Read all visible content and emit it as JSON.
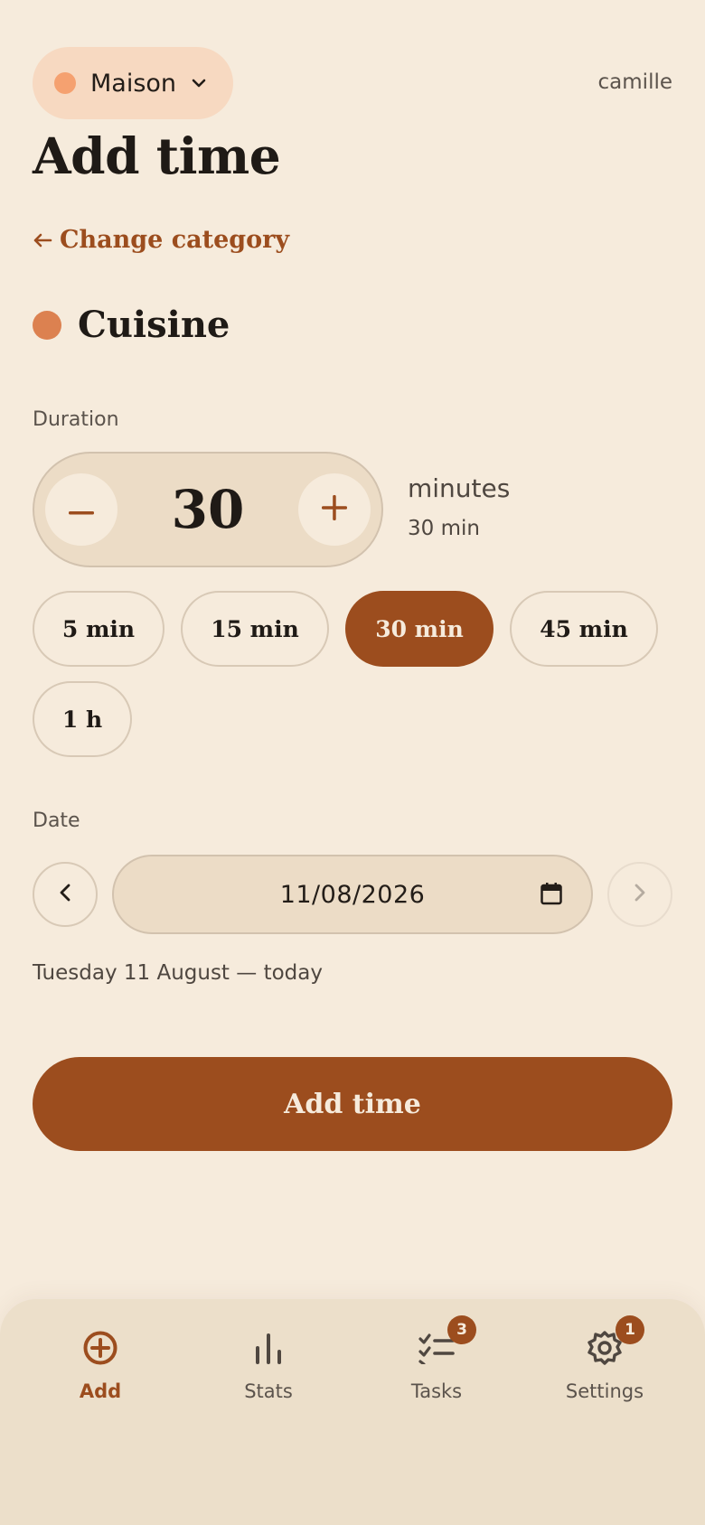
{
  "header": {
    "household": "Maison",
    "household_color": "#f5a170",
    "user": "camille"
  },
  "page": {
    "title": "Add time",
    "back_link": "Change category"
  },
  "category": {
    "name": "Cuisine",
    "color": "#dc8150"
  },
  "duration": {
    "label": "Duration",
    "value": "30",
    "unit": "minutes",
    "summary": "30 min",
    "presets": [
      "5 min",
      "15 min",
      "30 min",
      "45 min",
      "1 h"
    ],
    "selected_preset": "30 min"
  },
  "date": {
    "label": "Date",
    "value": "11/08/2026",
    "description": "Tuesday 11 August — today"
  },
  "submit_label": "Add time",
  "nav": {
    "items": [
      {
        "label": "Add",
        "icon": "plus-circle-icon",
        "active": true
      },
      {
        "label": "Stats",
        "icon": "bar-chart-icon"
      },
      {
        "label": "Tasks",
        "icon": "checklist-icon",
        "badge": "3"
      },
      {
        "label": "Settings",
        "icon": "gear-icon",
        "badge": "1"
      }
    ]
  },
  "colors": {
    "background": "#f6ebdc",
    "accent": "#9c4d1e",
    "surface": "#ecdcc6"
  }
}
